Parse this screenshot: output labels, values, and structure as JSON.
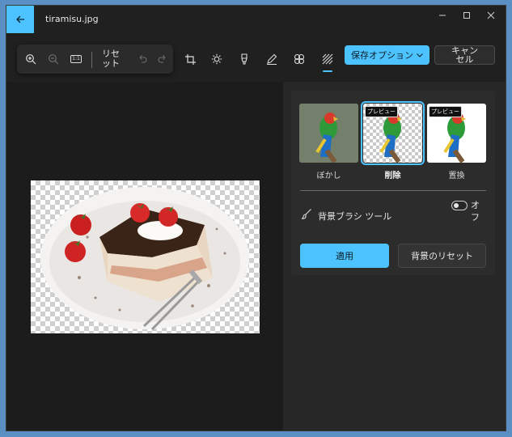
{
  "window": {
    "title": "tiramisu.jpg",
    "back_icon": "arrow-left-icon",
    "controls": [
      "minimize-icon",
      "maximize-icon",
      "close-icon"
    ]
  },
  "toolbar": {
    "zoom_in_icon": "zoom-in-icon",
    "zoom_out_icon": "zoom-out-icon",
    "actual_size_label": "1:1",
    "reset_label": "リセット",
    "undo_icon": "undo-icon",
    "redo_icon": "redo-icon",
    "tools": [
      "crop-icon",
      "brightness-icon",
      "marker-icon",
      "pen-icon",
      "filter-icon",
      "background-icon"
    ],
    "active_tool": "background-icon",
    "save_label": "保存オプション",
    "cancel_label": "キャンセル",
    "accent_color": "#4cc2ff"
  },
  "panel": {
    "options": [
      {
        "label": "ぼかし",
        "preview_tag": "",
        "selected": false
      },
      {
        "label": "削除",
        "preview_tag": "プレビュー",
        "selected": true
      },
      {
        "label": "置換",
        "preview_tag": "プレビュー",
        "selected": false
      }
    ],
    "brush_tool_label": "背景ブラシ ツール",
    "toggle_state_label": "オフ",
    "apply_label": "適用",
    "reset_bg_label": "背景のリセット"
  }
}
